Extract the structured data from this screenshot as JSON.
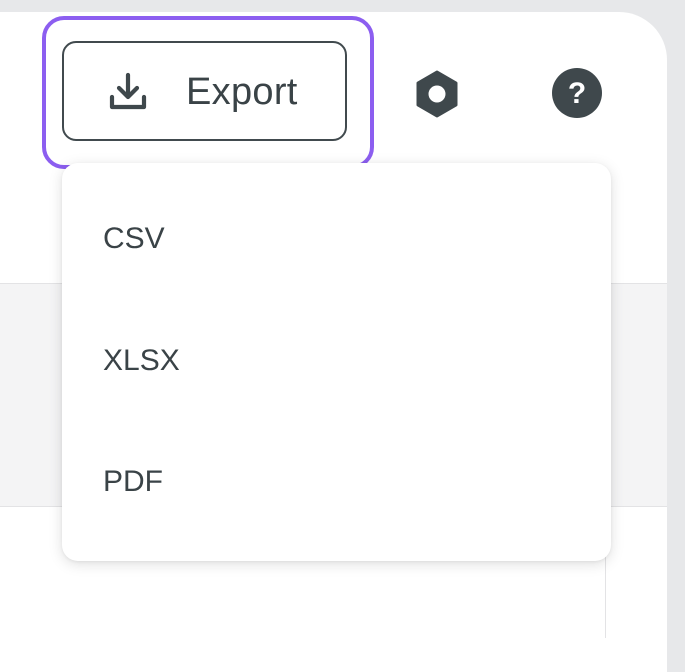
{
  "toolbar": {
    "export_label": "Export",
    "export_icon": "download-icon",
    "settings_icon": "hexagon-settings-icon",
    "help_icon": "help-circle-icon",
    "help_glyph": "?"
  },
  "export_menu": {
    "items": [
      {
        "label": "CSV"
      },
      {
        "label": "XLSX"
      },
      {
        "label": "PDF"
      }
    ]
  },
  "colors": {
    "focus_ring": "#8c5ef0",
    "text": "#3a4347",
    "icon": "#3f484c",
    "background": "#e7e8ea"
  }
}
